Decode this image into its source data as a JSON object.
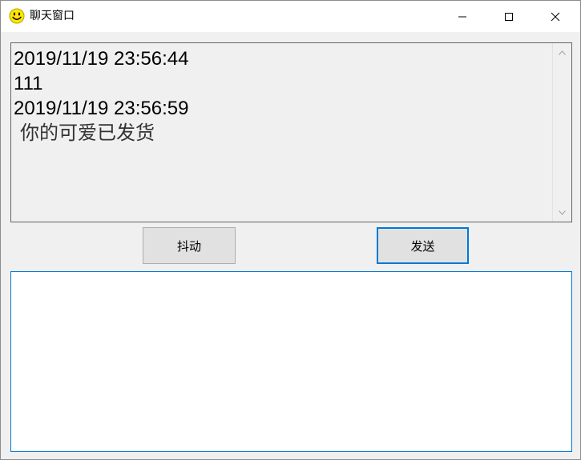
{
  "window": {
    "title": "聊天窗口",
    "app_icon": "smiley-face-icon",
    "controls": [
      "minimize-icon",
      "maximize-icon",
      "close-icon"
    ]
  },
  "history": {
    "messages": [
      {
        "timestamp": "2019/11/19 23:56:44",
        "text": "111"
      },
      {
        "timestamp": "2019/11/19 23:56:59",
        "text": "你的可爱已发货"
      }
    ]
  },
  "buttons": {
    "shake_label": "抖动",
    "send_label": "发送"
  },
  "compose": {
    "value": "",
    "placeholder": ""
  },
  "colors": {
    "accent": "#0078d7",
    "window_bg": "#f0f0f0",
    "icon_yellow": "#ffe600"
  }
}
